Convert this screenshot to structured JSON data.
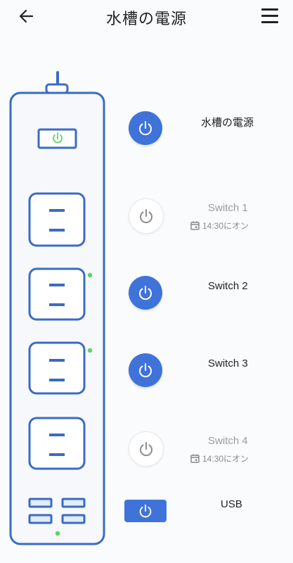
{
  "header": {
    "title": "水槽の電源"
  },
  "colors": {
    "accent": "#3f73d9",
    "indicator": "#5cd65c",
    "off_text": "#9c9c9c"
  },
  "outlets": [
    {
      "label": "水槽の電源",
      "state": "on",
      "schedule": null
    },
    {
      "label": "Switch 1",
      "state": "off",
      "schedule": "14:30にオン"
    },
    {
      "label": "Switch 2",
      "state": "on",
      "schedule": null
    },
    {
      "label": "Switch 3",
      "state": "on",
      "schedule": null
    },
    {
      "label": "Switch 4",
      "state": "off",
      "schedule": "14:30にオン"
    },
    {
      "label": "USB",
      "state": "on",
      "schedule": null
    }
  ],
  "icons": {
    "back": "arrow-left-icon",
    "menu": "hamburger-menu-icon",
    "power": "power-icon",
    "schedule": "calendar-icon"
  }
}
